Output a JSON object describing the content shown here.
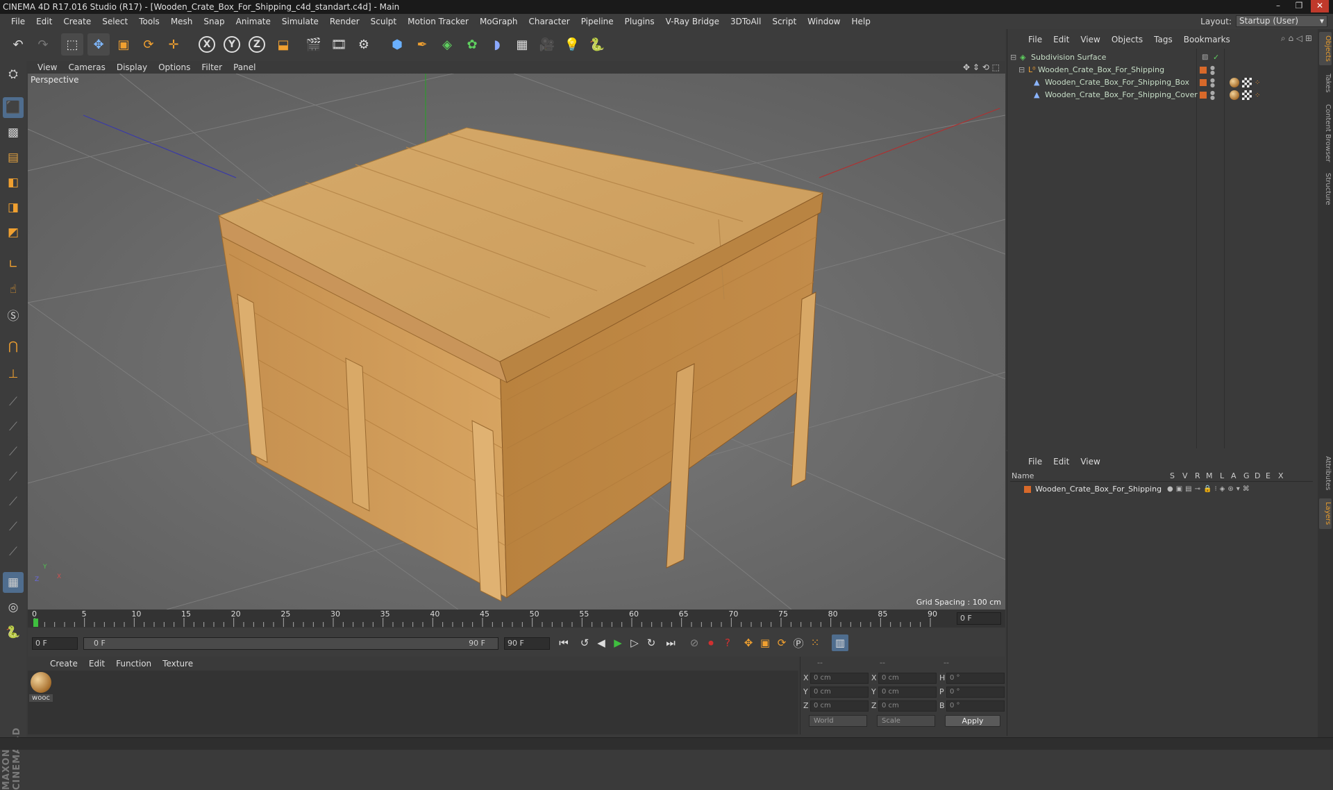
{
  "window": {
    "title": "CINEMA 4D R17.016 Studio (R17) - [Wooden_Crate_Box_For_Shipping_c4d_standart.c4d] - Main"
  },
  "menubar": {
    "items": [
      "File",
      "Edit",
      "Create",
      "Select",
      "Tools",
      "Mesh",
      "Snap",
      "Animate",
      "Simulate",
      "Render",
      "Sculpt",
      "Motion Tracker",
      "MoGraph",
      "Character",
      "Pipeline",
      "Plugins",
      "V-Ray Bridge",
      "3DToAll",
      "Script",
      "Window",
      "Help"
    ],
    "layout_label": "Layout:",
    "layout_value": "Startup (User)"
  },
  "toolbar": {
    "axis_x": "X",
    "axis_y": "Y",
    "axis_z": "Z"
  },
  "viewport": {
    "menu": [
      "View",
      "Cameras",
      "Display",
      "Options",
      "Filter",
      "Panel"
    ],
    "label": "Perspective",
    "grid_spacing": "Grid Spacing : 100 cm",
    "axis_x": "X",
    "axis_y": "Y",
    "axis_z": "Z"
  },
  "timeline": {
    "ticks": [
      "0",
      "5",
      "10",
      "15",
      "20",
      "25",
      "30",
      "35",
      "40",
      "45",
      "50",
      "55",
      "60",
      "65",
      "70",
      "75",
      "80",
      "85",
      "90"
    ],
    "current_frame": "0 F",
    "start_frame": "0 F",
    "range_start": "0 F",
    "range_end": "90 F",
    "end_frame": "90 F"
  },
  "material_manager": {
    "menu": [
      "Create",
      "Edit",
      "Function",
      "Texture"
    ],
    "material_name": "wooc"
  },
  "coordinates": {
    "header": [
      "--",
      "--",
      "--"
    ],
    "rows": [
      {
        "axis": "X",
        "pos": "0 cm",
        "axis2": "X",
        "size": "0 cm",
        "axis3": "H",
        "rot": "0 °"
      },
      {
        "axis": "Y",
        "pos": "0 cm",
        "axis2": "Y",
        "size": "0 cm",
        "axis3": "P",
        "rot": "0 °"
      },
      {
        "axis": "Z",
        "pos": "0 cm",
        "axis2": "Z",
        "size": "0 cm",
        "axis3": "B",
        "rot": "0 °"
      }
    ],
    "mode1": "World",
    "mode2": "Scale",
    "apply": "Apply"
  },
  "object_manager": {
    "menu": [
      "File",
      "Edit",
      "View",
      "Objects",
      "Tags",
      "Bookmarks"
    ],
    "objects": [
      {
        "name": "Subdivision Surface"
      },
      {
        "name": "Wooden_Crate_Box_For_Shipping"
      },
      {
        "name": "Wooden_Crate_Box_For_Shipping_Box"
      },
      {
        "name": "Wooden_Crate_Box_For_Shipping_Cover"
      }
    ]
  },
  "layer_manager": {
    "menu": [
      "File",
      "Edit",
      "View"
    ],
    "columns": [
      "Name",
      "S",
      "V",
      "R",
      "M",
      "L",
      "A",
      "G",
      "D",
      "E",
      "X"
    ],
    "layer_name": "Wooden_Crate_Box_For_Shipping",
    "layer_color": "#d8692a"
  },
  "right_tabs": [
    "Objects",
    "Takes",
    "Content Browser",
    "Structure",
    "Attributes",
    "Layers"
  ],
  "left_logo": "MAXON CINEMA 4D",
  "colors": {
    "accent_orange": "#d8692a",
    "play_green": "#3fbf3f",
    "record_red": "#d03030",
    "tool_blue": "#4f6d8e"
  }
}
